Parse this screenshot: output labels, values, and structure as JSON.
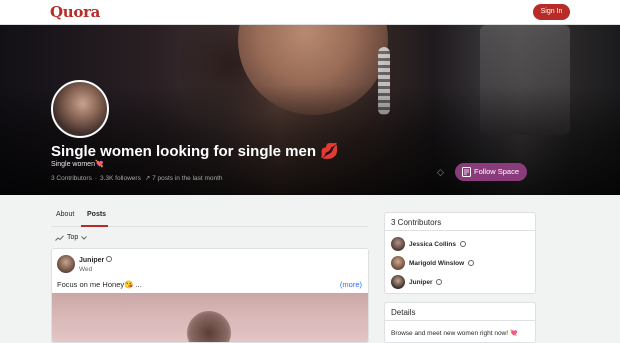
{
  "header": {
    "logo": "Quora",
    "signin_label": "Sign In"
  },
  "space": {
    "title": "Single women looking for single men 💋",
    "subtitle": "Single women💘",
    "contributors": "3 Contributors",
    "followers": "3.3K followers",
    "posts_last_month": "7 posts in the last month",
    "follow_label": "Follow Space"
  },
  "tabs": {
    "about": "About",
    "posts": "Posts"
  },
  "sort": {
    "label": "Top"
  },
  "post": {
    "author": "Juniper",
    "date": "Wed",
    "text": "Focus on me Honey😘 ...",
    "more": "(more)"
  },
  "contributors_card": {
    "title": "3 Contributors",
    "people": [
      {
        "name": "Jessica Collins"
      },
      {
        "name": "Marigold Winslow"
      },
      {
        "name": "Juniper"
      }
    ]
  },
  "details_card": {
    "title": "Details",
    "text": "Browse and meet new women right now! 💘"
  },
  "colors": {
    "brand": "#b92b27",
    "follow_button": "#8a3b7b",
    "link": "#2e69ff"
  }
}
